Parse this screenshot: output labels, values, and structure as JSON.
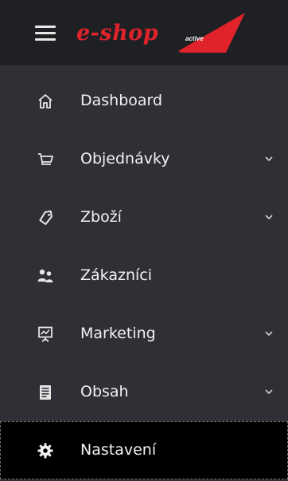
{
  "header": {
    "menu_toggle_icon": "hamburger-icon",
    "logo": {
      "text": "e-shop",
      "badge": "active",
      "brand_color": "#e0232b"
    }
  },
  "menu": {
    "items": [
      {
        "label": "Dashboard",
        "icon": "home-icon",
        "has_submenu": false,
        "active": false
      },
      {
        "label": "Objednávky",
        "icon": "cart-icon",
        "has_submenu": true,
        "active": false
      },
      {
        "label": "Zboží",
        "icon": "tag-icon",
        "has_submenu": true,
        "active": false
      },
      {
        "label": "Zákazníci",
        "icon": "users-icon",
        "has_submenu": false,
        "active": false
      },
      {
        "label": "Marketing",
        "icon": "presentation-chart-icon",
        "has_submenu": true,
        "active": false
      },
      {
        "label": "Obsah",
        "icon": "document-icon",
        "has_submenu": true,
        "active": false
      },
      {
        "label": "Nastavení",
        "icon": "gear-icon",
        "has_submenu": false,
        "active": true
      }
    ]
  },
  "colors": {
    "sidebar_bg": "#2e3035",
    "header_bg": "#1f2024",
    "active_bg": "#000000",
    "text": "#f2f2f2"
  }
}
